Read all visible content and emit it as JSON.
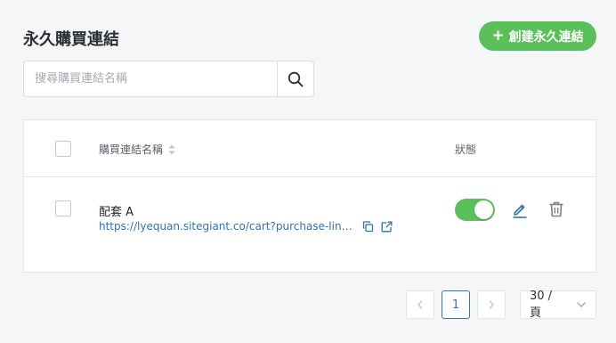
{
  "page": {
    "title": "永久購買連結",
    "create_button_label": "創建永久連結"
  },
  "search": {
    "placeholder": "搜尋購買連結名稱",
    "value": ""
  },
  "table": {
    "columns": {
      "name": "購買連結名稱",
      "status": "狀態"
    },
    "rows": [
      {
        "name": "配套 A",
        "link": "https://lyequan.sitegiant.co/cart?purchase-link=2⋯",
        "enabled": true
      }
    ]
  },
  "pagination": {
    "current_page": "1",
    "page_size": "30 / 頁"
  },
  "colors": {
    "accent_green": "#5cc05a",
    "link_blue": "#2f72b5"
  },
  "icons": [
    "plus-icon",
    "search-icon",
    "sort-icon",
    "copy-icon",
    "external-link-icon",
    "edit-icon",
    "trash-icon",
    "chevron-left-icon",
    "chevron-right-icon",
    "chevron-down-icon"
  ]
}
